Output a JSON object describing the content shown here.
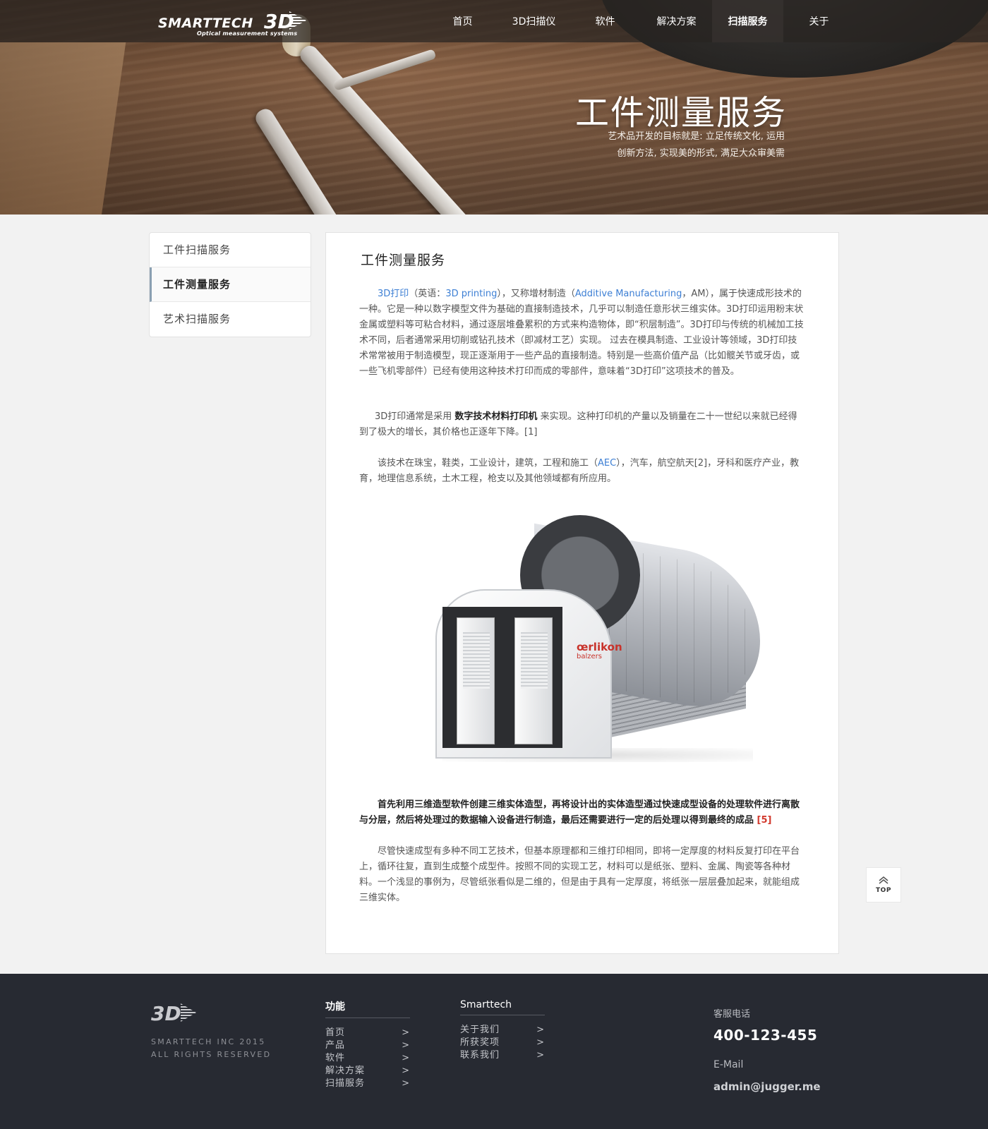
{
  "nav": {
    "logo_brand": "SMARTTECH",
    "logo_3d": "3D",
    "logo_tagline": "Optical measurement systems",
    "items": [
      "首页",
      "3D扫描仪",
      "软件",
      "解决方案",
      "扫描服务",
      "关于"
    ],
    "active": "扫描服务"
  },
  "hero": {
    "title": "工件测量服务",
    "subtitle_line1": "艺术品开发的目标就是: 立足传统文化, 运用",
    "subtitle_line2": "创新方法, 实现美的形式, 满足大众审美需"
  },
  "sidebar": {
    "items": [
      "工件扫描服务",
      "工件测量服务",
      "艺术扫描服务"
    ],
    "active": "工件测量服务"
  },
  "article": {
    "heading": "工件测量服务",
    "p1": {
      "link1": "3D打印",
      "t1": "（英语：",
      "link2": "3D printing",
      "t2": "），又称增材制造（",
      "link3": "Additive Manufacturing",
      "t3": "，AM），属于快速成形技术的一种。它是一种以数字模型文件为基础的直接制造技术，几乎可以制造任意形状三维实体。3D打印运用粉末状金属或塑料等可粘合材料，通过逐层堆叠累积的方式来构造物体，即“积层制造”。3D打印与传统的机械加工技术不同，后者通常采用切削或钻孔技术（即减材工艺）实现。 过去在模具制造、工业设计等领域，3D打印技术常常被用于制造模型，现正逐渐用于一些产品的直接制造。特别是一些高价值产品（比如髋关节或牙齿，或一些飞机零部件）已经有使用这种技术打印而成的零部件，意味着“3D打印”这项技术的普及。"
    },
    "p2": {
      "t1": "3D打印通常是采用 ",
      "bold": "数字技术材料打印机",
      "t2": " 来实现。这种打印机的产量以及销量在二十一世纪以来就已经得到了极大的增长，其价格也正逐年下降。[1]"
    },
    "p3": {
      "t1": "该技术在珠宝，鞋类，工业设计，建筑，工程和施工（",
      "link": "AEC",
      "t2": "），汽车，航空航天[2]，牙科和医疗产业，教育，地理信息系统，土木工程，枪支以及其他领域都有所应用。"
    },
    "image_brand": "œrlikon",
    "image_brand_sub": "balzers",
    "p4": {
      "t1": "首先利用三维造型软件创建三维实体造型，再将设计出的实体造型通过快速成型设备的处理软件进行离散与分层，然后将处理过的数据输入设备进行制造，最后还需要进行一定的后处理以得到最终的成品 ",
      "ref": "[5]"
    },
    "p5": "尽管快速成型有多种不同工艺技术，但基本原理都和三维打印相同，即将一定厚度的材料反复打印在平台上，循环往复，直到生成整个成型件。按照不同的实现工艺，材料可以是纸张、塑料、金属、陶瓷等各种材料。一个浅显的事例为，尽管纸张看似是二维的，但是由于具有一定厚度，将纸张一层层叠加起来，就能组成三维实体。"
  },
  "top_button": "TOP",
  "footer": {
    "logo": "3D",
    "copy_line1": "SMARTTECH INC 2015",
    "copy_line2": "ALL RIGHTS RESERVED",
    "col1": {
      "heading": "功能",
      "links": [
        "首页",
        "产品",
        "软件",
        "解决方案",
        "扫描服务"
      ]
    },
    "col2": {
      "heading": "Smarttech",
      "links": [
        "关于我们",
        "所获奖项",
        "联系我们"
      ]
    },
    "arrow": ">",
    "phone_label": "客服电话",
    "phone": "400-123-455",
    "email_label": "E-Mail",
    "email": "admin@jugger.me"
  }
}
